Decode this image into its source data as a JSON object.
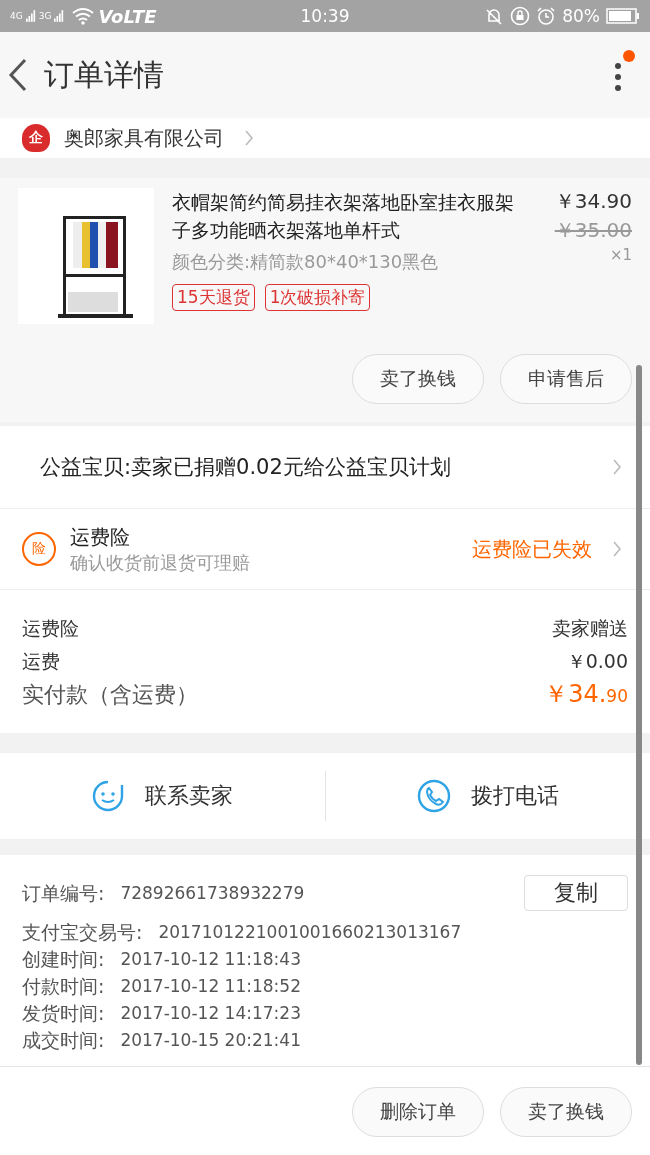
{
  "status_bar": {
    "network_1": "4G",
    "network_2": "3G",
    "volte": "VoLTE",
    "time": "10:39",
    "battery": "80%"
  },
  "header": {
    "title": "订单详情",
    "notification_dot": true
  },
  "shop": {
    "name": "奥郎家具有限公司",
    "badge": "企"
  },
  "product": {
    "kind": "picture",
    "title": "衣帽架简约简易挂衣架落地卧室挂衣服架子多功能晒衣架落地单杆式",
    "variant": "颜色分类:精简款80*40*130黑色",
    "price": "￥34.90",
    "original_price": "￥35.00",
    "quantity": "×1",
    "tags": [
      "15天退货",
      "1次破损补寄"
    ],
    "buttons": [
      "卖了换钱",
      "申请售后"
    ]
  },
  "charity": {
    "text": "公益宝贝:卖家已捐赠0.02元给公益宝贝计划"
  },
  "insurance": {
    "icon": "险",
    "title": "运费险",
    "subtitle": "确认收货前退货可理赔",
    "status": "运费险已失效"
  },
  "costs": [
    {
      "label": "运费险",
      "value": "卖家赠送"
    },
    {
      "label": "运费",
      "value": "￥0.00"
    }
  ],
  "total": {
    "label": "实付款（含运费）",
    "amount": "￥34.",
    "cents": "90"
  },
  "contact": [
    {
      "kind": "chat",
      "label": "联系卖家"
    },
    {
      "kind": "phone",
      "label": "拨打电话"
    }
  ],
  "order_info": {
    "copy_button": "复制",
    "rows": [
      {
        "label": "订单编号:",
        "value": "72892661738932279"
      },
      {
        "label": "支付宝交易号:",
        "value": "2017101221001001660213013167"
      },
      {
        "label": "创建时间:",
        "value": "2017-10-12 11:18:43"
      },
      {
        "label": "付款时间:",
        "value": "2017-10-12 11:18:52"
      },
      {
        "label": "发货时间:",
        "value": "2017-10-12 14:17:23"
      },
      {
        "label": "成交时间:",
        "value": "2017-10-15 20:21:41"
      }
    ]
  },
  "bottom_buttons": [
    "删除订单",
    "卖了换钱"
  ]
}
